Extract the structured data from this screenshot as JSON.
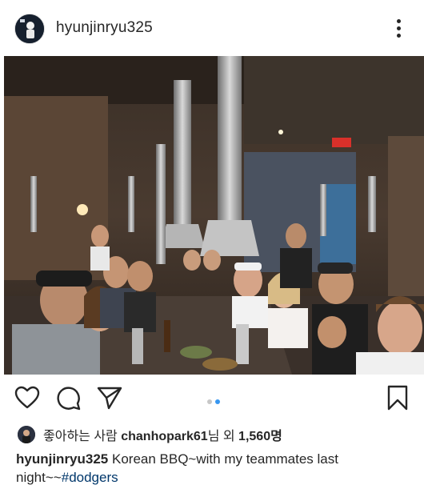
{
  "post": {
    "username": "hyunjinryu325",
    "more_icon": "more-vertical-icon"
  },
  "actions": {
    "like_icon": "heart-icon",
    "comment_icon": "comment-icon",
    "share_icon": "paper-plane-icon",
    "save_icon": "bookmark-icon",
    "carousel": {
      "count": 2,
      "active": 2,
      "active_color": "#3897f0",
      "inactive_color": "#c7c7c7"
    }
  },
  "likes": {
    "prefix": "좋아하는 사람 ",
    "user": "chanhopark61",
    "mid": "님 외 ",
    "count": "1,560명"
  },
  "caption": {
    "username": "hyunjinryu325",
    "text": " Korean BBQ~with my teammates last night~~",
    "hashtag": "#dodgers"
  }
}
